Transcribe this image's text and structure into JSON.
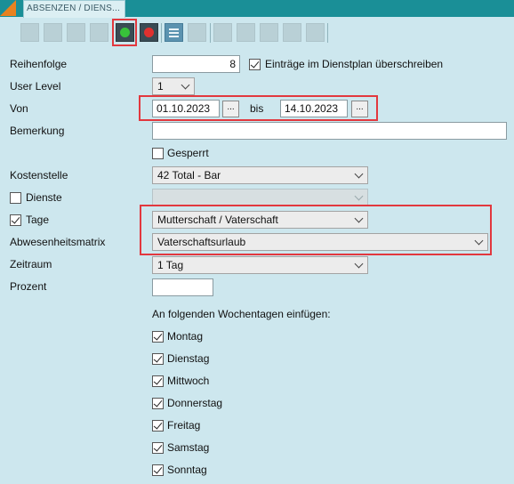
{
  "tab_title": "ABSENZEN / DIENS...",
  "toolbar": {
    "buttons": [
      "save-icon",
      "save-new-icon",
      "copy-icon",
      "delete-icon",
      "confirm-icon",
      "cancel-icon",
      "list-icon",
      "export-icon",
      "first-icon",
      "prev-icon",
      "next-icon",
      "last-icon",
      "refresh-icon"
    ]
  },
  "form": {
    "reihenfolge_label": "Reihenfolge",
    "reihenfolge_value": "8",
    "overwrite_label": "Einträge im Dienstplan überschreiben",
    "overwrite_checked": true,
    "user_level_label": "User Level",
    "user_level_value": "1",
    "von_label": "Von",
    "von_value": "01.10.2023",
    "bis_label": "bis",
    "bis_value": "14.10.2023",
    "date_button": "...",
    "bemerkung_label": "Bemerkung",
    "bemerkung_value": "",
    "gesperrt_label": "Gesperrt",
    "gesperrt_checked": false,
    "kostenstelle_label": "Kostenstelle",
    "kostenstelle_value": "42 Total - Bar",
    "dienste_label": "Dienste",
    "dienste_checked": false,
    "dienste_value": "",
    "tage_label": "Tage",
    "tage_checked": true,
    "tage_value": "Mutterschaft / Vaterschaft",
    "matrix_label": "Abwesenheitsmatrix",
    "matrix_value": "Vaterschaftsurlaub",
    "zeitraum_label": "Zeitraum",
    "zeitraum_value": "1 Tag",
    "prozent_label": "Prozent",
    "prozent_value": "",
    "weekdays_heading": "An folgenden Wochentagen einfügen:",
    "weekdays": [
      {
        "label": "Montag",
        "checked": true
      },
      {
        "label": "Dienstag",
        "checked": true
      },
      {
        "label": "Mittwoch",
        "checked": true
      },
      {
        "label": "Donnerstag",
        "checked": true
      },
      {
        "label": "Freitag",
        "checked": true
      },
      {
        "label": "Samstag",
        "checked": true
      },
      {
        "label": "Sonntag",
        "checked": true
      }
    ]
  },
  "colors": {
    "background": "#cde7ee",
    "titlebar": "#1a8f97",
    "highlight": "#e2383e",
    "accent_corner": "#e8821f"
  }
}
